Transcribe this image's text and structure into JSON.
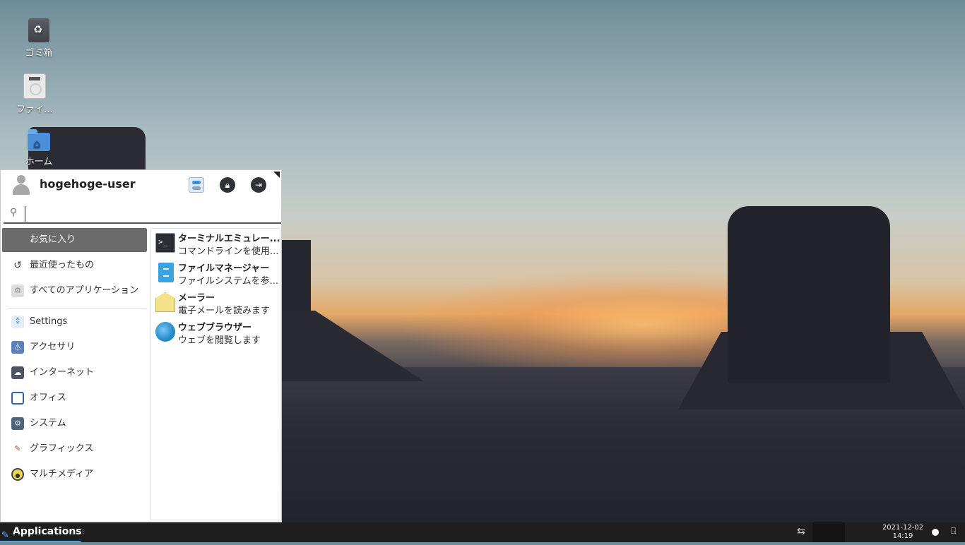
{
  "desktop": {
    "icons": [
      {
        "label": "ゴミ箱",
        "icon": "trash-icon"
      },
      {
        "label": "ファイ...",
        "icon": "disk-icon"
      },
      {
        "label": "ホーム",
        "icon": "home-folder-icon"
      }
    ]
  },
  "menu": {
    "username": "hogehoge-user",
    "search": {
      "value": "",
      "placeholder": ""
    },
    "categories": [
      {
        "label": "お気に入り",
        "icon": "star-icon"
      },
      {
        "label": "最近使ったもの",
        "icon": "history-icon"
      },
      {
        "label": "すべてのアプリケーション",
        "icon": "all-apps-icon"
      },
      {
        "label": "Settings",
        "icon": "settings-icon"
      },
      {
        "label": "アクセサリ",
        "icon": "accessories-icon"
      },
      {
        "label": "インターネット",
        "icon": "internet-icon"
      },
      {
        "label": "オフィス",
        "icon": "office-icon"
      },
      {
        "label": "システム",
        "icon": "system-icon"
      },
      {
        "label": "グラフィックス",
        "icon": "graphics-icon"
      },
      {
        "label": "マルチメディア",
        "icon": "multimedia-icon"
      }
    ],
    "apps": [
      {
        "name": "ターミナルエミュレー...",
        "desc": "コマンドラインを使用...",
        "icon": "terminal-icon"
      },
      {
        "name": "ファイルマネージャー",
        "desc": "ファイルシステムを参...",
        "icon": "file-manager-icon"
      },
      {
        "name": "メーラー",
        "desc": "電子メールを読みます",
        "icon": "mail-icon"
      },
      {
        "name": "ウェブブラウザー",
        "desc": "ウェブを閲覧します",
        "icon": "web-browser-icon"
      }
    ]
  },
  "taskbar": {
    "apps_label": "Applications",
    "date": "2021-12-02",
    "time": "14:19"
  },
  "colors": {
    "accent": "#5aa3e0",
    "active_category": "#6b6b6b",
    "taskbar": "#1e1e1e"
  }
}
